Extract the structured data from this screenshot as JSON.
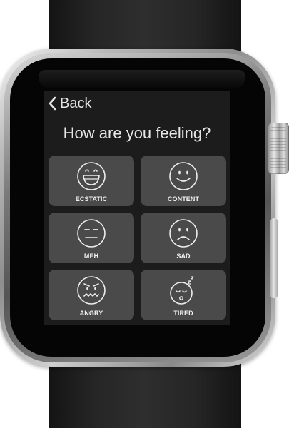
{
  "header": {
    "back_label": "Back",
    "title": "How are you feeling?"
  },
  "moods": [
    {
      "label": "ECSTATIC",
      "icon": "ecstatic-face-icon"
    },
    {
      "label": "CONTENT",
      "icon": "content-face-icon"
    },
    {
      "label": "MEH",
      "icon": "meh-face-icon"
    },
    {
      "label": "SAD",
      "icon": "sad-face-icon"
    },
    {
      "label": "ANGRY",
      "icon": "angry-face-icon"
    },
    {
      "label": "TIRED",
      "icon": "tired-face-icon"
    }
  ],
  "colors": {
    "screen_bg": "#1c1c1c",
    "tile_bg": "#4a4a4a",
    "text": "#e6e6e6",
    "band": "#262626"
  }
}
